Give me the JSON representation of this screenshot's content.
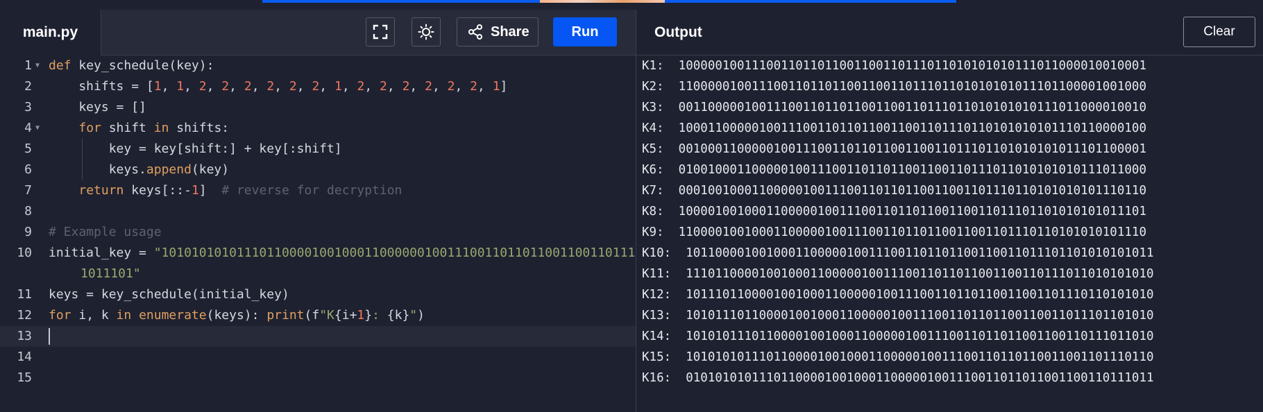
{
  "editor": {
    "filename": "main.py",
    "share_label": "Share",
    "run_label": "Run",
    "lines": [
      {
        "num": "1"
      },
      {
        "num": "2"
      },
      {
        "num": "3"
      },
      {
        "num": "4"
      },
      {
        "num": "5"
      },
      {
        "num": "6"
      },
      {
        "num": "7"
      },
      {
        "num": "8"
      },
      {
        "num": "9"
      },
      {
        "num": "10"
      },
      {
        "num": "11"
      },
      {
        "num": "12"
      },
      {
        "num": "13"
      },
      {
        "num": "14"
      },
      {
        "num": "15"
      }
    ],
    "code": {
      "l7_comment": "# reverse for decryption",
      "l9_comment": "# Example usage",
      "l10_string_a": "\"10101010101110110000100100011000000100111001101101100110011011101\"",
      "l10_string_b": "1011101\""
    }
  },
  "output": {
    "title": "Output",
    "clear_label": "Clear",
    "lines": [
      "K1:  1000001001110011011011001100110111011010101010111011000010010001",
      "K2:  1100000100111001101101100110011011101101010101011101100001001000",
      "K3:  0011000001001110011011011001100110111011010101010111011000010010",
      "K4:  1000110000010011100110110110011001101110110101010101110110000100",
      "K5:  0010001100000100111001101101100110011011101101010101011101100001",
      "K6:  0100100011000001001110011011011001100110111011010101010111011000",
      "K7:  0001001000110000010011100110110110011001101110110101010101110110",
      "K8:  1000010010001100000100111001101101100110011011101101010101011101",
      "K9:  1100001001000110000010011100110110110011001101110110101010101110",
      "K10:  1011000010010001100000100111001101101100110011011101101010101011",
      "K11:  1110110000100100011000001001110011011011001100110111011010101010",
      "K12:  1011101100001001000110000010011100110110110011001101110110101010",
      "K13:  1010111011000010010001100000100111001101101100110011011101101010",
      "K14:  1010101110110000100100011000001001110011011011001100110111011010",
      "K15:  1010101011101100001001000110000010011100110110110011001101110110",
      "K16:  0101010101110110000100100011000001001110011011011001100110111011"
    ]
  },
  "colors": {
    "background": "#1e2130",
    "run_button": "#0556f3",
    "keyword": "#e0a060",
    "number": "#f07860",
    "string": "#98a870",
    "comment": "#5d6272"
  },
  "icons": [
    "fullscreen-icon",
    "theme-sun-icon",
    "share-icon",
    "fold-arrow-icon"
  ]
}
